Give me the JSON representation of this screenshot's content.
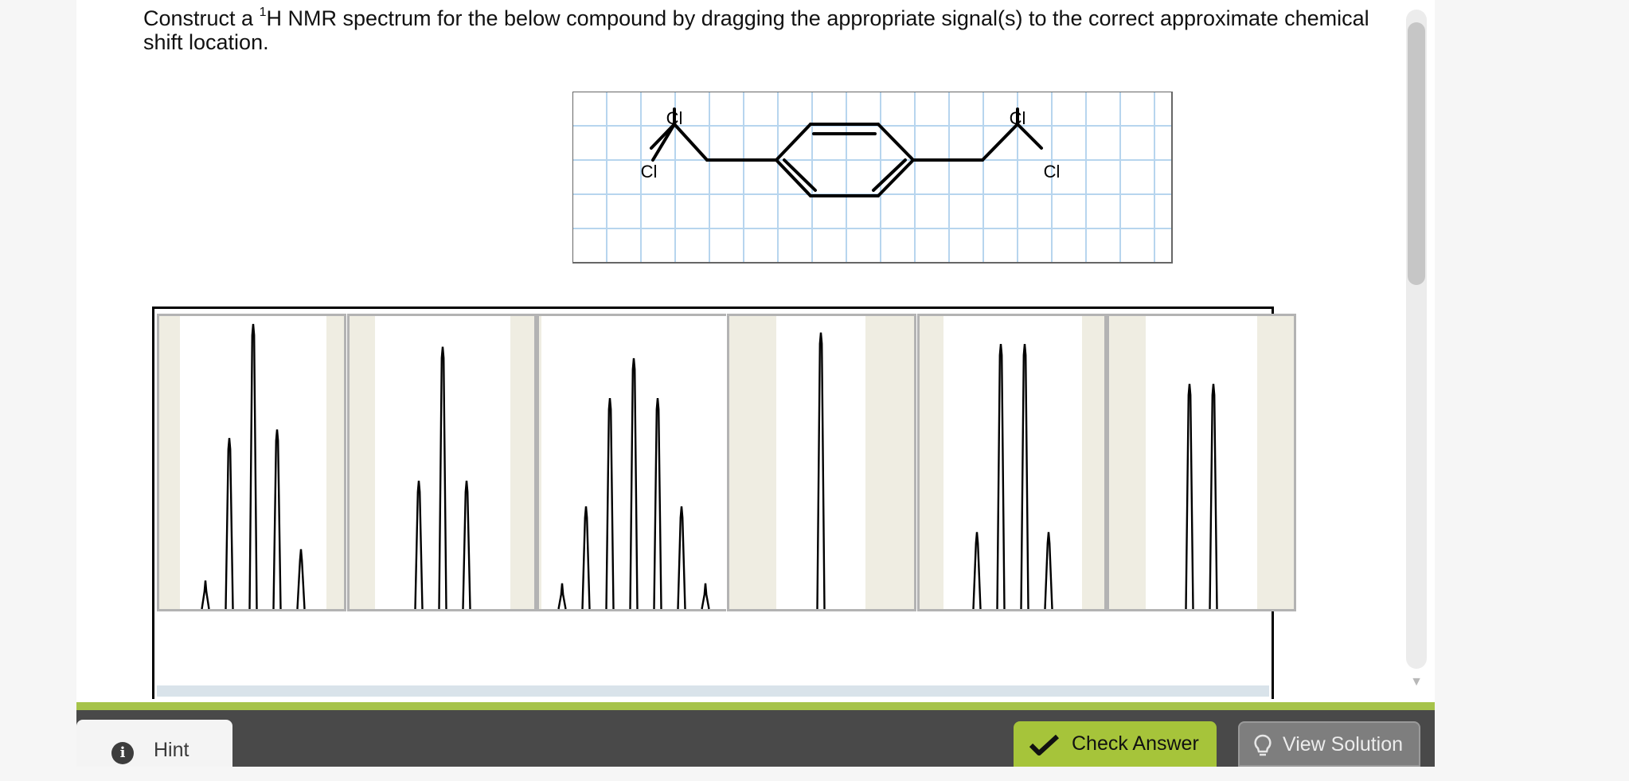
{
  "question": {
    "text_before": "Construct a ",
    "superscript": "1",
    "text_after": "H NMR spectrum for the below compound by dragging the appropriate signal(s) to the correct approximate chemical shift location."
  },
  "molecule": {
    "atom_labels": [
      "Cl",
      "Cl",
      "Cl",
      "Cl"
    ]
  },
  "signals": [
    {
      "name": "quintet",
      "peaks": [
        0.1,
        0.6,
        1.0,
        0.63,
        0.21
      ]
    },
    {
      "name": "triplet",
      "peaks": [
        0.45,
        0.92,
        0.45
      ]
    },
    {
      "name": "septet",
      "peaks": [
        0.09,
        0.36,
        0.74,
        0.88,
        0.74,
        0.36,
        0.09
      ]
    },
    {
      "name": "singlet",
      "peaks": [
        0.97
      ]
    },
    {
      "name": "doublet of doublets",
      "peaks": [
        0.27,
        0.93,
        0.93,
        0.27
      ]
    },
    {
      "name": "doublet",
      "peaks": [
        0.79,
        0.79
      ]
    }
  ],
  "footer": {
    "hint_label": "Hint",
    "check_label": "Check Answer",
    "solution_label": "View Solution"
  },
  "colors": {
    "accent": "#a6c43a",
    "footer_bg": "#494949",
    "grid": "#b7d5ee",
    "tile_margin": "#efede2"
  }
}
